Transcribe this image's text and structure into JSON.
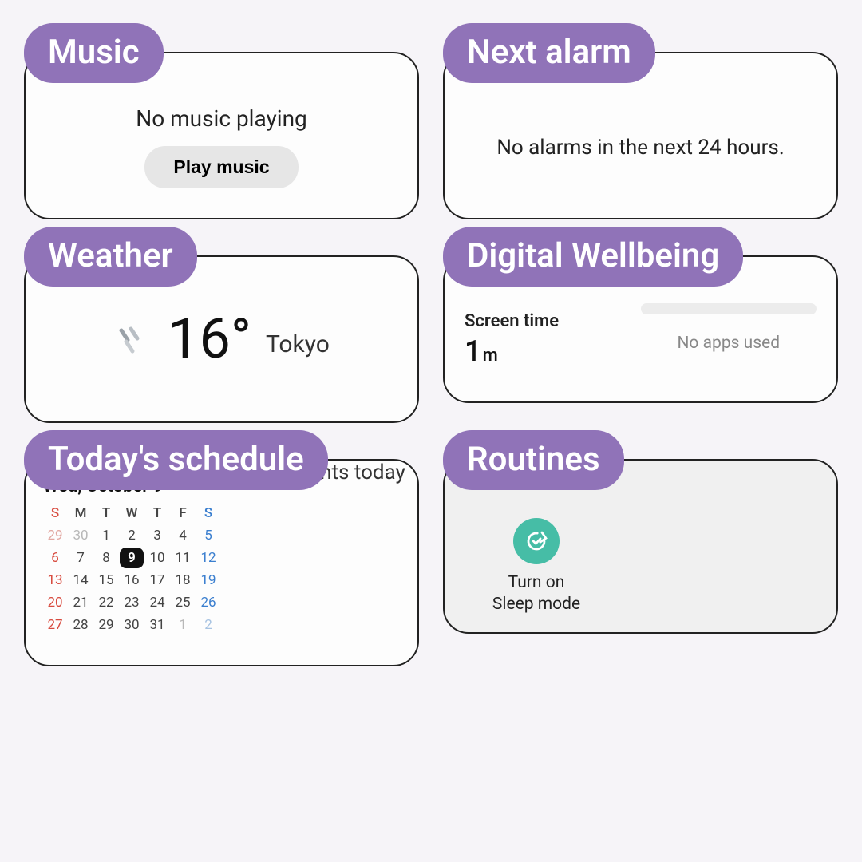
{
  "colors": {
    "accent": "#9073b8",
    "routineIcon": "#46bda6"
  },
  "widgets": {
    "music": {
      "title": "Music",
      "status": "No music playing",
      "play_label": "Play music"
    },
    "alarm": {
      "title": "Next alarm",
      "message": "No alarms in the next 24 hours."
    },
    "weather": {
      "title": "Weather",
      "temp": "16°",
      "city": "Tokyo",
      "condition_icon": "light-rain"
    },
    "wellbeing": {
      "title": "Digital Wellbeing",
      "screen_time_label": "Screen time",
      "screen_time_value": "1",
      "screen_time_unit": "m",
      "no_apps": "No apps used"
    },
    "schedule": {
      "title": "Today's schedule",
      "date_heading": "Wed, October 9",
      "weekday_headers": [
        "S",
        "M",
        "T",
        "W",
        "T",
        "F",
        "S"
      ],
      "weeks": [
        [
          {
            "n": "29",
            "cls": "fadeR"
          },
          {
            "n": "30",
            "cls": "fade"
          },
          {
            "n": "1",
            "cls": ""
          },
          {
            "n": "2",
            "cls": ""
          },
          {
            "n": "3",
            "cls": ""
          },
          {
            "n": "4",
            "cls": ""
          },
          {
            "n": "5",
            "cls": "satdate"
          }
        ],
        [
          {
            "n": "6",
            "cls": "sundate"
          },
          {
            "n": "7",
            "cls": ""
          },
          {
            "n": "8",
            "cls": ""
          },
          {
            "n": "9",
            "cls": "today"
          },
          {
            "n": "10",
            "cls": ""
          },
          {
            "n": "11",
            "cls": ""
          },
          {
            "n": "12",
            "cls": "satdate"
          }
        ],
        [
          {
            "n": "13",
            "cls": "sundate"
          },
          {
            "n": "14",
            "cls": ""
          },
          {
            "n": "15",
            "cls": ""
          },
          {
            "n": "16",
            "cls": ""
          },
          {
            "n": "17",
            "cls": ""
          },
          {
            "n": "18",
            "cls": ""
          },
          {
            "n": "19",
            "cls": "satdate"
          }
        ],
        [
          {
            "n": "20",
            "cls": "sundate"
          },
          {
            "n": "21",
            "cls": ""
          },
          {
            "n": "22",
            "cls": ""
          },
          {
            "n": "23",
            "cls": ""
          },
          {
            "n": "24",
            "cls": ""
          },
          {
            "n": "25",
            "cls": ""
          },
          {
            "n": "26",
            "cls": "satdate"
          }
        ],
        [
          {
            "n": "27",
            "cls": "sundate"
          },
          {
            "n": "28",
            "cls": ""
          },
          {
            "n": "29",
            "cls": ""
          },
          {
            "n": "30",
            "cls": ""
          },
          {
            "n": "31",
            "cls": ""
          },
          {
            "n": "1",
            "cls": "fade"
          },
          {
            "n": "2",
            "cls": "fadeB"
          }
        ]
      ],
      "no_events": "No events today"
    },
    "routines": {
      "title": "Routines",
      "items": [
        {
          "label_line1": "Turn on",
          "label_line2": "Sleep mode"
        }
      ]
    }
  }
}
